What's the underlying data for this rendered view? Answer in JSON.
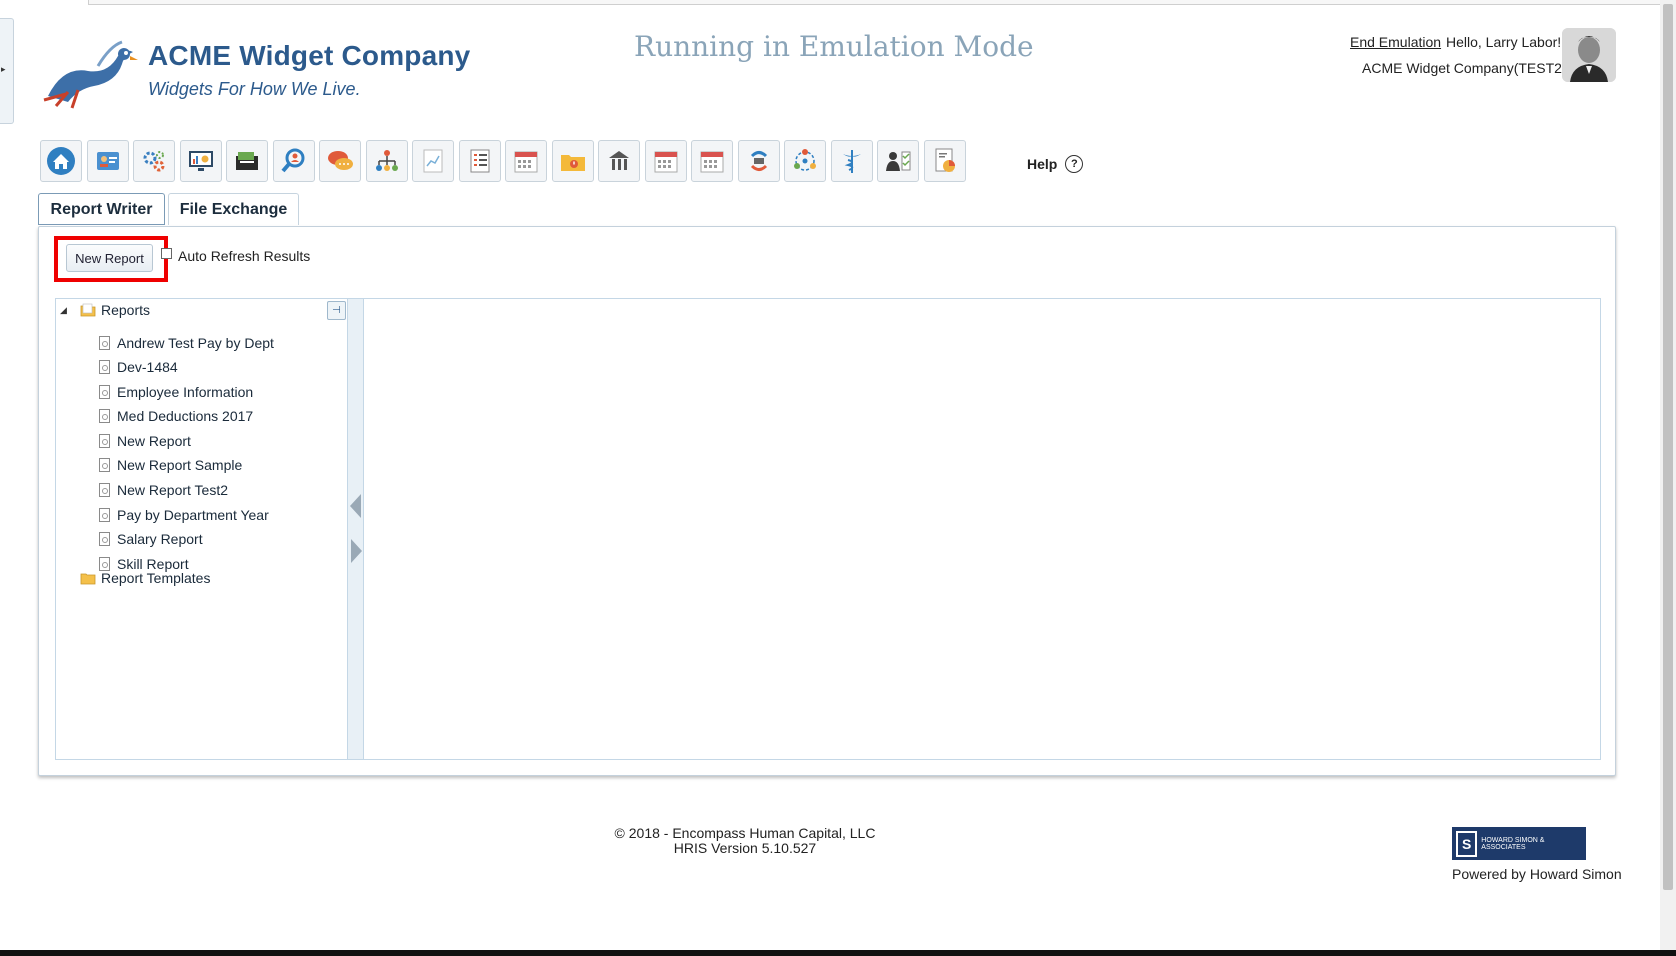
{
  "header": {
    "company_name": "ACME Widget Company",
    "company_tagline": "Widgets For How We Live.",
    "emulation_banner": "Running in Emulation Mode",
    "end_emulation": "End Emulation",
    "greeting": "Hello, Larry Labor!",
    "company_code": "ACME Widget Company(TEST2)"
  },
  "toolbar": {
    "icons": [
      "home-icon",
      "employee-card-icon",
      "settings-gears-icon",
      "dashboard-monitor-icon",
      "payroll-money-icon",
      "search-person-icon",
      "chat-bubbles-icon",
      "org-chart-icon",
      "report-chart-icon",
      "checklist-icon",
      "calendar-icon",
      "folder-alert-icon",
      "building-icon",
      "calendar-icon",
      "calendar-icon",
      "sync-arrows-icon",
      "network-people-icon",
      "medical-caduceus-icon",
      "manager-icon",
      "document-pie-icon"
    ],
    "help_label": "Help",
    "help_glyph": "?"
  },
  "tabs": [
    {
      "label": "Report Writer",
      "active": true
    },
    {
      "label": "File Exchange",
      "active": false
    }
  ],
  "actions": {
    "new_report_label": "New Report",
    "auto_refresh_label": "Auto Refresh Results",
    "auto_refresh_checked": false
  },
  "tree": {
    "root_label": "Reports",
    "items": [
      "Andrew Test Pay by Dept",
      "Dev-1484",
      "Employee Information",
      "Med Deductions 2017",
      "New Report",
      "New Report Sample",
      "New Report Test2",
      "Pay by Department Year",
      "Salary Report",
      "Skill Report"
    ],
    "templates_label": "Report Templates"
  },
  "footer": {
    "copyright": "© 2018 - Encompass Human Capital, LLC",
    "version": "HRIS Version 5.10.527",
    "hs_logo_text": "HOWARD SIMON & ASSOCIATES",
    "powered_by": "Powered by Howard Simon"
  },
  "colors": {
    "brand_blue": "#2c5a8c",
    "emulation_text": "#8aa4b8",
    "highlight_red": "#ef0000"
  }
}
